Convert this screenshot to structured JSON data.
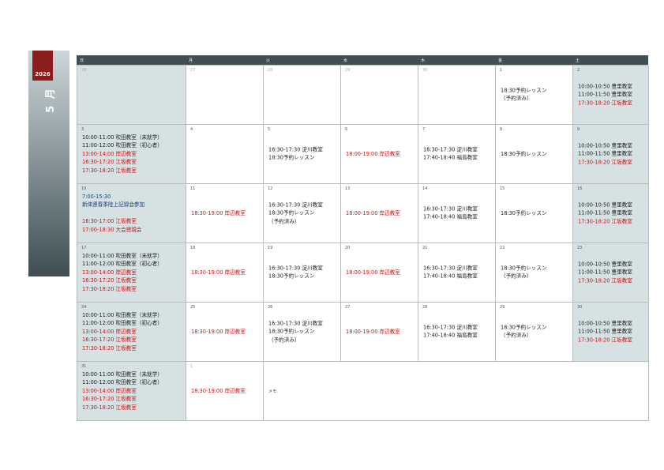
{
  "side": {
    "year": "2026",
    "month": "5 月"
  },
  "days": [
    "日",
    "月",
    "火",
    "水",
    "木",
    "金",
    "土"
  ],
  "weeks": [
    [
      {
        "date": "26",
        "faint": true,
        "weekend": true,
        "events": []
      },
      {
        "date": "27",
        "faint": true,
        "events": []
      },
      {
        "date": "28",
        "faint": true,
        "events": []
      },
      {
        "date": "29",
        "faint": true,
        "events": []
      },
      {
        "date": "30",
        "faint": true,
        "events": []
      },
      {
        "date": "1",
        "events": [
          {
            "text": "18:30予約レッスン"
          },
          {
            "text": "（予約済み）"
          }
        ]
      },
      {
        "date": "2",
        "weekend": true,
        "events": [
          {
            "text": "10:00-10:50  豊里教室"
          },
          {
            "text": "11:00-11:50  豊里教室"
          },
          {
            "text": "17:30-18:20  江坂教室",
            "color": "red"
          }
        ]
      }
    ],
    [
      {
        "date": "3",
        "weekend": true,
        "events": [
          {
            "text": "10:00-11:00  吹田教室（未就学）"
          },
          {
            "text": "11:00-12:00  吹田教室（初心者）"
          },
          {
            "text": "13:00-14:00  岸辺教室",
            "color": "red"
          },
          {
            "text": "16:30-17:20  江坂教室",
            "color": "red"
          },
          {
            "text": "17:30-18:20  江坂教室",
            "color": "red"
          }
        ]
      },
      {
        "date": "4",
        "events": []
      },
      {
        "date": "5",
        "events": [
          {
            "text": "16:30-17:30  淀川教室"
          },
          {
            "text": "18:30予約レッスン"
          }
        ]
      },
      {
        "date": "6",
        "events": [
          {
            "text": "18:00-19:00 岸辺教室",
            "color": "red"
          }
        ]
      },
      {
        "date": "7",
        "events": [
          {
            "text": "16:30-17:30  淀川教室"
          },
          {
            "text": "17:40-18:40  福島教室"
          }
        ]
      },
      {
        "date": "8",
        "events": [
          {
            "text": "18:30予約レッスン"
          }
        ]
      },
      {
        "date": "9",
        "weekend": true,
        "events": [
          {
            "text": "10:00-10:50  豊里教室"
          },
          {
            "text": "11:00-11:50  豊里教室"
          },
          {
            "text": "17:30-18:20  江坂教室",
            "color": "red"
          }
        ]
      }
    ],
    [
      {
        "date": "10",
        "weekend": true,
        "events": [
          {
            "text": "7:00-15:30",
            "color": "blue"
          },
          {
            "text": "新体連春季陸上記録会参加",
            "color": "blue"
          },
          {
            "text": ""
          },
          {
            "text": "16:30-17:00  江坂教室",
            "color": "red"
          },
          {
            "text": "17:00-18:30  大会懇親会",
            "color": "red"
          }
        ]
      },
      {
        "date": "11",
        "events": [
          {
            "text": "18:30-19:00 岸辺教室",
            "color": "red"
          }
        ]
      },
      {
        "date": "12",
        "events": [
          {
            "text": "16:30-17:30  淀川教室"
          },
          {
            "text": "18:30予約レッスン"
          },
          {
            "text": "（予約済み）"
          }
        ]
      },
      {
        "date": "13",
        "events": [
          {
            "text": "18:00-19:00 岸辺教室",
            "color": "red"
          }
        ]
      },
      {
        "date": "14",
        "events": [
          {
            "text": "16:30-17:30  淀川教室"
          },
          {
            "text": "17:40-18:40  福島教室"
          }
        ]
      },
      {
        "date": "15",
        "events": [
          {
            "text": "18:30予約レッスン"
          }
        ]
      },
      {
        "date": "16",
        "weekend": true,
        "events": [
          {
            "text": "10:00-10:50  豊里教室"
          },
          {
            "text": "11:00-11:50  豊里教室"
          },
          {
            "text": "17:30-18:20  江坂教室",
            "color": "red"
          }
        ]
      }
    ],
    [
      {
        "date": "17",
        "weekend": true,
        "events": [
          {
            "text": "10:00-11:00  吹田教室（未就学）"
          },
          {
            "text": "11:00-12:00  吹田教室（初心者）"
          },
          {
            "text": "13:00-14:00  岸辺教室",
            "color": "red"
          },
          {
            "text": "16:30-17:20  江坂教室",
            "color": "red"
          },
          {
            "text": "17:30-18:20  江坂教室",
            "color": "red"
          }
        ]
      },
      {
        "date": "18",
        "events": [
          {
            "text": "18:30-19:00 岸辺教室",
            "color": "red"
          }
        ]
      },
      {
        "date": "19",
        "events": [
          {
            "text": "16:30-17:30  淀川教室"
          },
          {
            "text": "18:30予約レッスン"
          }
        ]
      },
      {
        "date": "20",
        "events": [
          {
            "text": "18:00-19:00 岸辺教室",
            "color": "red"
          }
        ]
      },
      {
        "date": "21",
        "events": [
          {
            "text": "16:30-17:30  淀川教室"
          },
          {
            "text": "17:40-18:40  福島教室"
          }
        ]
      },
      {
        "date": "22",
        "events": [
          {
            "text": "18:30予約レッスン"
          },
          {
            "text": "（予約済み）"
          }
        ]
      },
      {
        "date": "23",
        "weekend": true,
        "events": [
          {
            "text": "10:00-10:50  豊里教室"
          },
          {
            "text": "11:00-11:50  豊里教室"
          },
          {
            "text": "17:30-18:20  江坂教室",
            "color": "red"
          }
        ]
      }
    ],
    [
      {
        "date": "24",
        "weekend": true,
        "events": [
          {
            "text": "10:00-11:00  吹田教室（未就学）"
          },
          {
            "text": "11:00-12:00  吹田教室（初心者）"
          },
          {
            "text": "13:00-14:00  岸辺教室",
            "color": "red"
          },
          {
            "text": "16:30-17:20  江坂教室",
            "color": "red"
          },
          {
            "text": "17:30-18:20  江坂教室",
            "color": "red"
          }
        ]
      },
      {
        "date": "25",
        "events": [
          {
            "text": "18:30-19:00 岸辺教室",
            "color": "red"
          }
        ]
      },
      {
        "date": "26",
        "events": [
          {
            "text": "16:30-17:30  淀川教室"
          },
          {
            "text": "18:30予約レッスン"
          },
          {
            "text": "（予約済み）"
          }
        ]
      },
      {
        "date": "27",
        "events": [
          {
            "text": "18:00-19:00 岸辺教室",
            "color": "red"
          }
        ]
      },
      {
        "date": "28",
        "events": [
          {
            "text": "16:30-17:30  淀川教室"
          },
          {
            "text": "17:40-18:40  福島教室"
          }
        ]
      },
      {
        "date": "29",
        "events": [
          {
            "text": "18:30予約レッスン"
          },
          {
            "text": "（予約済み）"
          }
        ]
      },
      {
        "date": "30",
        "weekend": true,
        "events": [
          {
            "text": "10:00-10:50  豊里教室"
          },
          {
            "text": "11:00-11:50  豊里教室"
          },
          {
            "text": "17:30-18:20  江坂教室",
            "color": "red"
          }
        ]
      }
    ]
  ],
  "last_week": [
    {
      "date": "31",
      "weekend": true,
      "events": [
        {
          "text": "10:00-11:00  吹田教室（未就学）"
        },
        {
          "text": "11:00-12:00  吹田教室（初心者）"
        },
        {
          "text": "13:00-14:00  岸辺教室",
          "color": "red"
        },
        {
          "text": "16:30-17:20  江坂教室",
          "color": "red"
        },
        {
          "text": "17:30-18:20  江坂教室",
          "color": "red"
        }
      ]
    },
    {
      "date": "1",
      "faint": true,
      "events": [
        {
          "text": "18:30-19:00 岸辺教室",
          "color": "red"
        }
      ]
    }
  ],
  "memo_label": "メモ:"
}
